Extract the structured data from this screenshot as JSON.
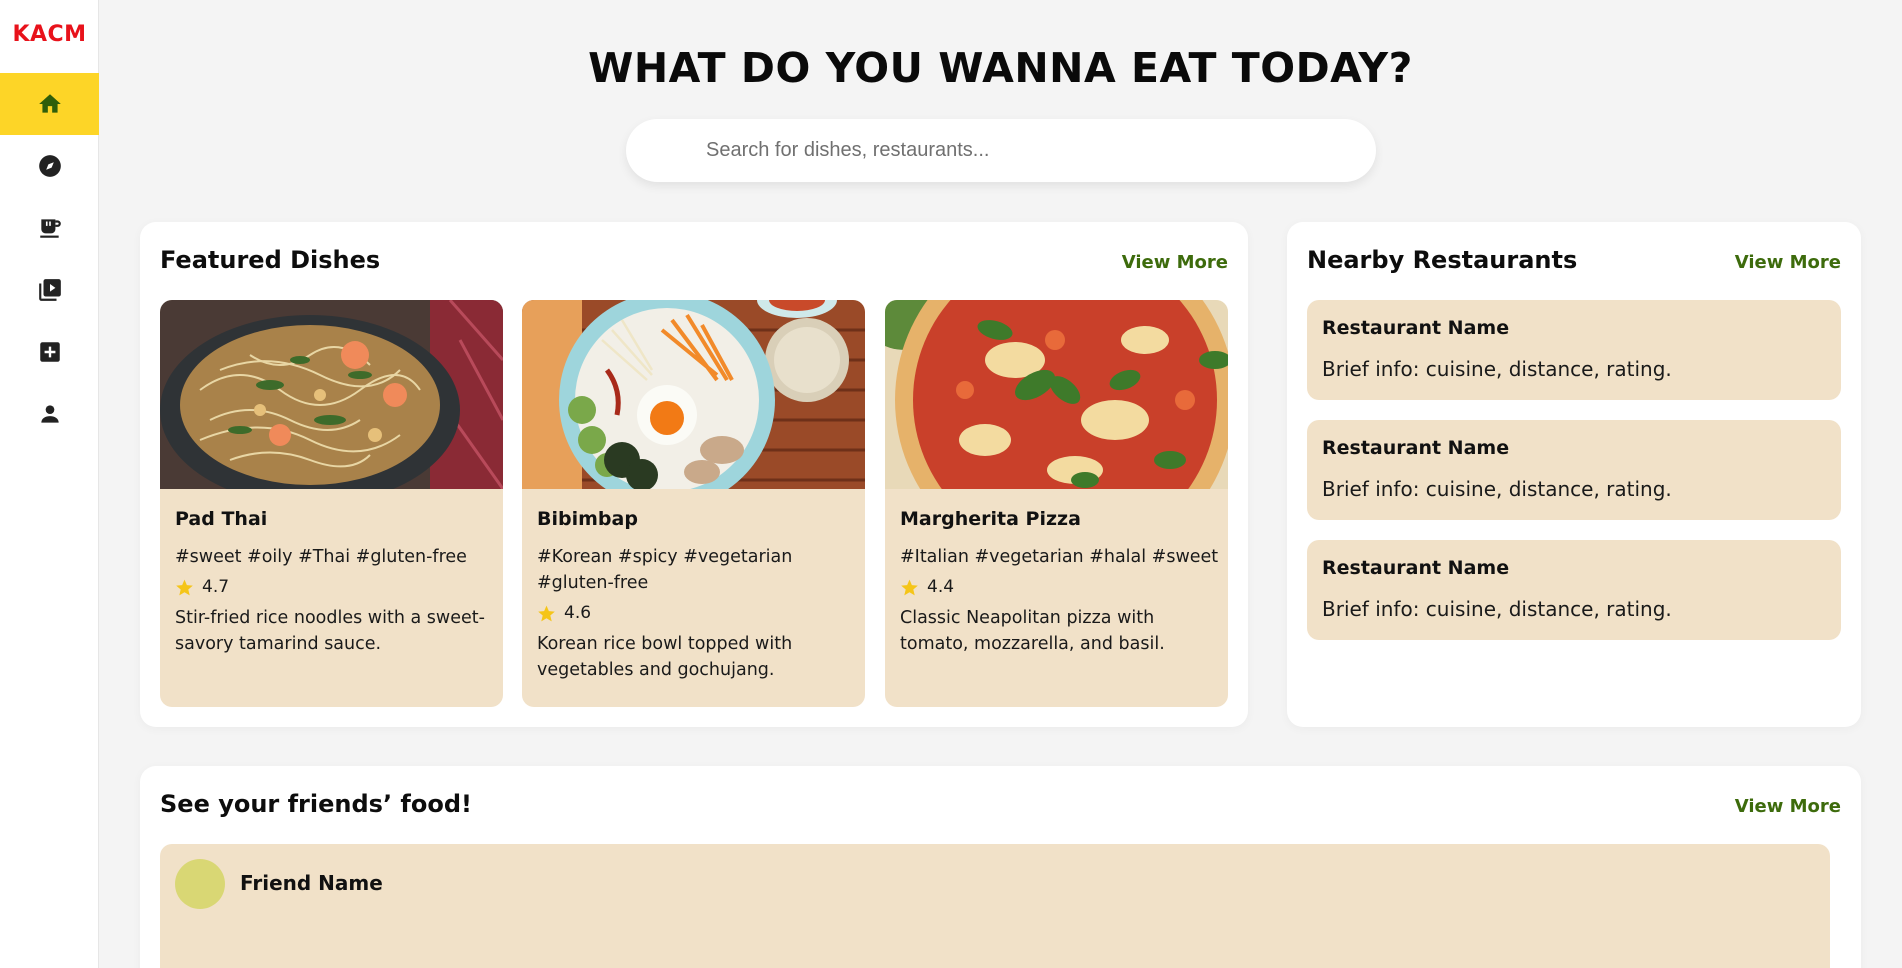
{
  "brand": {
    "logo_text": "KACM",
    "logo_color": "#e8121b"
  },
  "sidebar": {
    "items": [
      {
        "icon": "home-icon",
        "active": true
      },
      {
        "icon": "compass-icon",
        "active": false
      },
      {
        "icon": "coffee-cup-icon",
        "active": false
      },
      {
        "icon": "video-library-icon",
        "active": false
      },
      {
        "icon": "add-box-icon",
        "active": false
      },
      {
        "icon": "person-icon",
        "active": false
      }
    ],
    "active_color": "#fdd527"
  },
  "header": {
    "title": "WHAT DO YOU WANNA EAT TODAY?",
    "search_placeholder": "Search for dishes, restaurants..."
  },
  "featured": {
    "title": "Featured Dishes",
    "view_more": "View More",
    "dishes": [
      {
        "name": "Pad Thai",
        "tags": "#sweet #oily #Thai #gluten-free",
        "rating": "4.7",
        "description": "Stir-fried rice noodles with a sweet-savory tamarind sauce."
      },
      {
        "name": "Bibimbap",
        "tags": "#Korean #spicy #vegetarian #gluten-free",
        "rating": "4.6",
        "description": "Korean rice bowl topped with vegetables and gochujang."
      },
      {
        "name": "Margherita Pizza",
        "tags": "#Italian #vegetarian #halal #sweet",
        "rating": "4.4",
        "description": "Classic Neapolitan pizza with tomato, mozzarella, and basil."
      }
    ]
  },
  "nearby": {
    "title": "Nearby Restaurants",
    "view_more": "View More",
    "restaurants": [
      {
        "name": "Restaurant Name",
        "info": "Brief info: cuisine, distance, rating."
      },
      {
        "name": "Restaurant Name",
        "info": "Brief info: cuisine, distance, rating."
      },
      {
        "name": "Restaurant Name",
        "info": "Brief info: cuisine, distance, rating."
      }
    ]
  },
  "friends": {
    "title": "See your friends’ food!",
    "view_more": "View More",
    "posts": [
      {
        "friend_name": "Friend Name"
      }
    ]
  },
  "colors": {
    "accent_green": "#3d6b0c",
    "card_beige": "#f1e1c8",
    "star": "#f5c518"
  }
}
